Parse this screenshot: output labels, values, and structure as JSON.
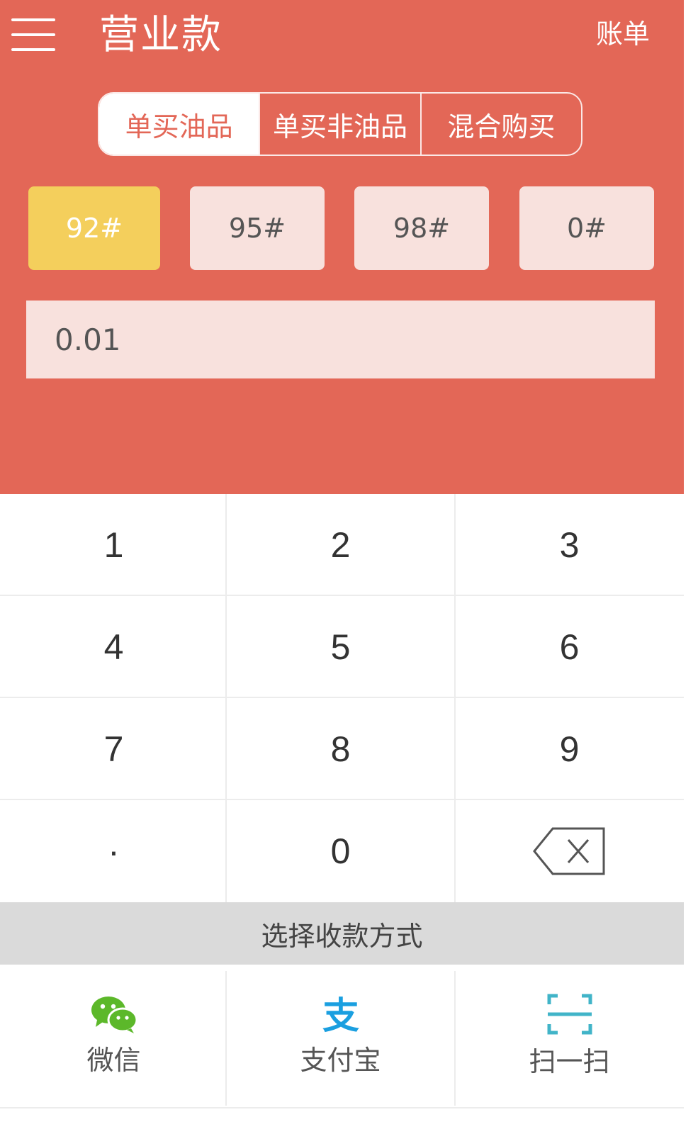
{
  "header": {
    "title": "营业款",
    "bill_label": "账单"
  },
  "tabs": [
    {
      "label": "单买油品",
      "active": true
    },
    {
      "label": "单买非油品",
      "active": false
    },
    {
      "label": "混合购买",
      "active": false
    }
  ],
  "fuel_grades": [
    {
      "label": "92#",
      "selected": true
    },
    {
      "label": "95#",
      "selected": false
    },
    {
      "label": "98#",
      "selected": false
    },
    {
      "label": "0#",
      "selected": false
    }
  ],
  "amount": {
    "value": "0.01"
  },
  "keypad": {
    "keys": [
      "1",
      "2",
      "3",
      "4",
      "5",
      "6",
      "7",
      "8",
      "9",
      "·",
      "0"
    ],
    "backspace_icon": "backspace-icon"
  },
  "payment": {
    "prompt": "选择收款方式",
    "methods": [
      {
        "label": "微信",
        "icon": "wechat-icon"
      },
      {
        "label": "支付宝",
        "icon": "alipay-icon"
      },
      {
        "label": "扫一扫",
        "icon": "scan-icon"
      }
    ]
  },
  "colors": {
    "header_bg": "#e36757",
    "selected_grade": "#f4cf5c",
    "chip_bg": "#f8e1dd",
    "wechat_green": "#5cb82a",
    "alipay_blue": "#1a9fe0",
    "scan_teal": "#41b4c8"
  }
}
